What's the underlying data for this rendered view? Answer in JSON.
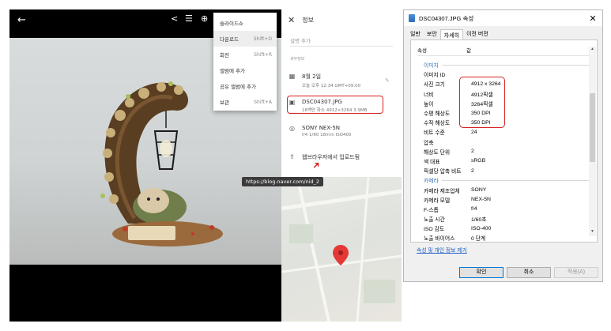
{
  "viewer": {
    "menu": [
      {
        "label": "슬라이드쇼",
        "shortcut": ""
      },
      {
        "label": "다운로드",
        "shortcut": "Shift+D"
      },
      {
        "label": "회전",
        "shortcut": "Shift+R"
      },
      {
        "label": "앨범에 추가",
        "shortcut": ""
      },
      {
        "label": "공유 앨범에 추가",
        "shortcut": ""
      },
      {
        "label": "보관",
        "shortcut": "Shift+A"
      }
    ],
    "tooltip": "https://blog.naver.com/nid_2"
  },
  "info_panel": {
    "title": "정보",
    "description_placeholder": "설명 추가",
    "section_label": "세부정보",
    "date": {
      "line1": "8월 2일",
      "line2": "오늘 오후 12:34   GMT+09:00"
    },
    "file": {
      "line1": "DSC04307.JPG",
      "line2": "16백만 화소   4912×3264   3.9MB"
    },
    "camera": {
      "line1": "SONY NEX-5N",
      "line2": "f/4   1/60   18mm   ISO400"
    },
    "upload": "웹브라우저에서 업로드됨"
  },
  "dialog": {
    "title": "DSC04307.JPG 속성",
    "tabs": [
      "일반",
      "보안",
      "자세히",
      "이전 버전"
    ],
    "columns": {
      "property": "속성",
      "value": "값"
    },
    "rows": [
      {
        "k": "이미지",
        "v": "",
        "section": true
      },
      {
        "k": "이미지 ID",
        "v": ""
      },
      {
        "k": "사진 크기",
        "v": "4912 x 3264"
      },
      {
        "k": "너비",
        "v": "4912픽셀"
      },
      {
        "k": "높이",
        "v": "3264픽셀"
      },
      {
        "k": "수평 해상도",
        "v": "350 DPI"
      },
      {
        "k": "수직 해상도",
        "v": "350 DPI"
      },
      {
        "k": "비트 수준",
        "v": "24"
      },
      {
        "k": "압축",
        "v": ""
      },
      {
        "k": "해상도 단위",
        "v": "2"
      },
      {
        "k": "색 대표",
        "v": "sRGB"
      },
      {
        "k": "픽셀당 압축 비트",
        "v": "2"
      },
      {
        "k": "카메라",
        "v": "",
        "section": true
      },
      {
        "k": "카메라 제조업체",
        "v": "SONY"
      },
      {
        "k": "카메라 모델",
        "v": "NEX-5N"
      },
      {
        "k": "F-스톱",
        "v": "f/4"
      },
      {
        "k": "노출 시간",
        "v": "1/60초"
      },
      {
        "k": "ISO 감도",
        "v": "ISO-400"
      },
      {
        "k": "노출 바이어스",
        "v": "0 단계"
      }
    ],
    "remove_link": "속성 및 개인 정보 제거",
    "buttons": {
      "ok": "확인",
      "cancel": "취소",
      "apply": "적용(A)"
    }
  },
  "colors": {
    "highlight": "#d82020",
    "link": "#1a5fc6",
    "section": "#3a6fb0"
  }
}
